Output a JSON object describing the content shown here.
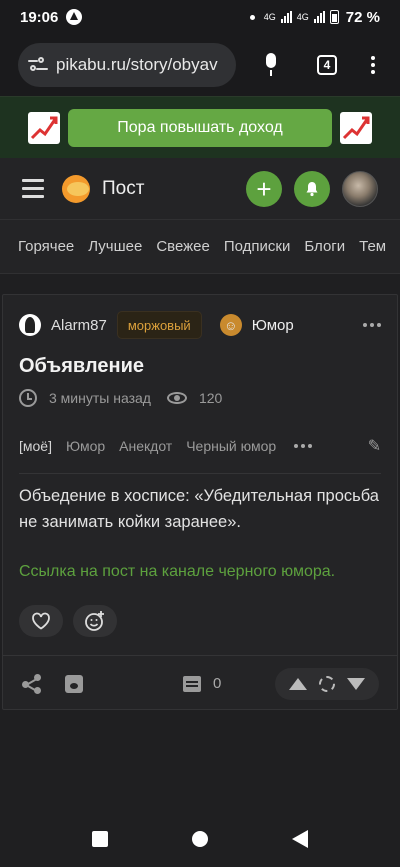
{
  "statusbar": {
    "time": "19:06",
    "battery": "72 %",
    "network_1": "4G",
    "network_2": "4G"
  },
  "browser": {
    "url": "pikabu.ru/story/obyav",
    "tab_count": "4"
  },
  "banner": {
    "cta": "Пора повышать доход"
  },
  "header": {
    "title": "Пост"
  },
  "nav": {
    "tabs": [
      "Горячее",
      "Лучшее",
      "Свежее",
      "Подписки",
      "Блоги",
      "Тем"
    ]
  },
  "post": {
    "author": "Alarm87",
    "author_badge": "моржовый",
    "community": "Юмор",
    "title": "Объявление",
    "time_ago": "3 минуты назад",
    "views": "120",
    "tags": [
      "[моё]",
      "Юмор",
      "Анекдот",
      "Черный юмор"
    ],
    "body": "Объедение в хосписе: «Убедительная просьба не занимать койки заранее».",
    "link_text": "Ссылка на пост на канале черного юмора.",
    "comment_count": "0"
  },
  "colors": {
    "accent": "#5da13e",
    "banner_bg": "#1e3320",
    "badge_text": "#dba03b"
  }
}
